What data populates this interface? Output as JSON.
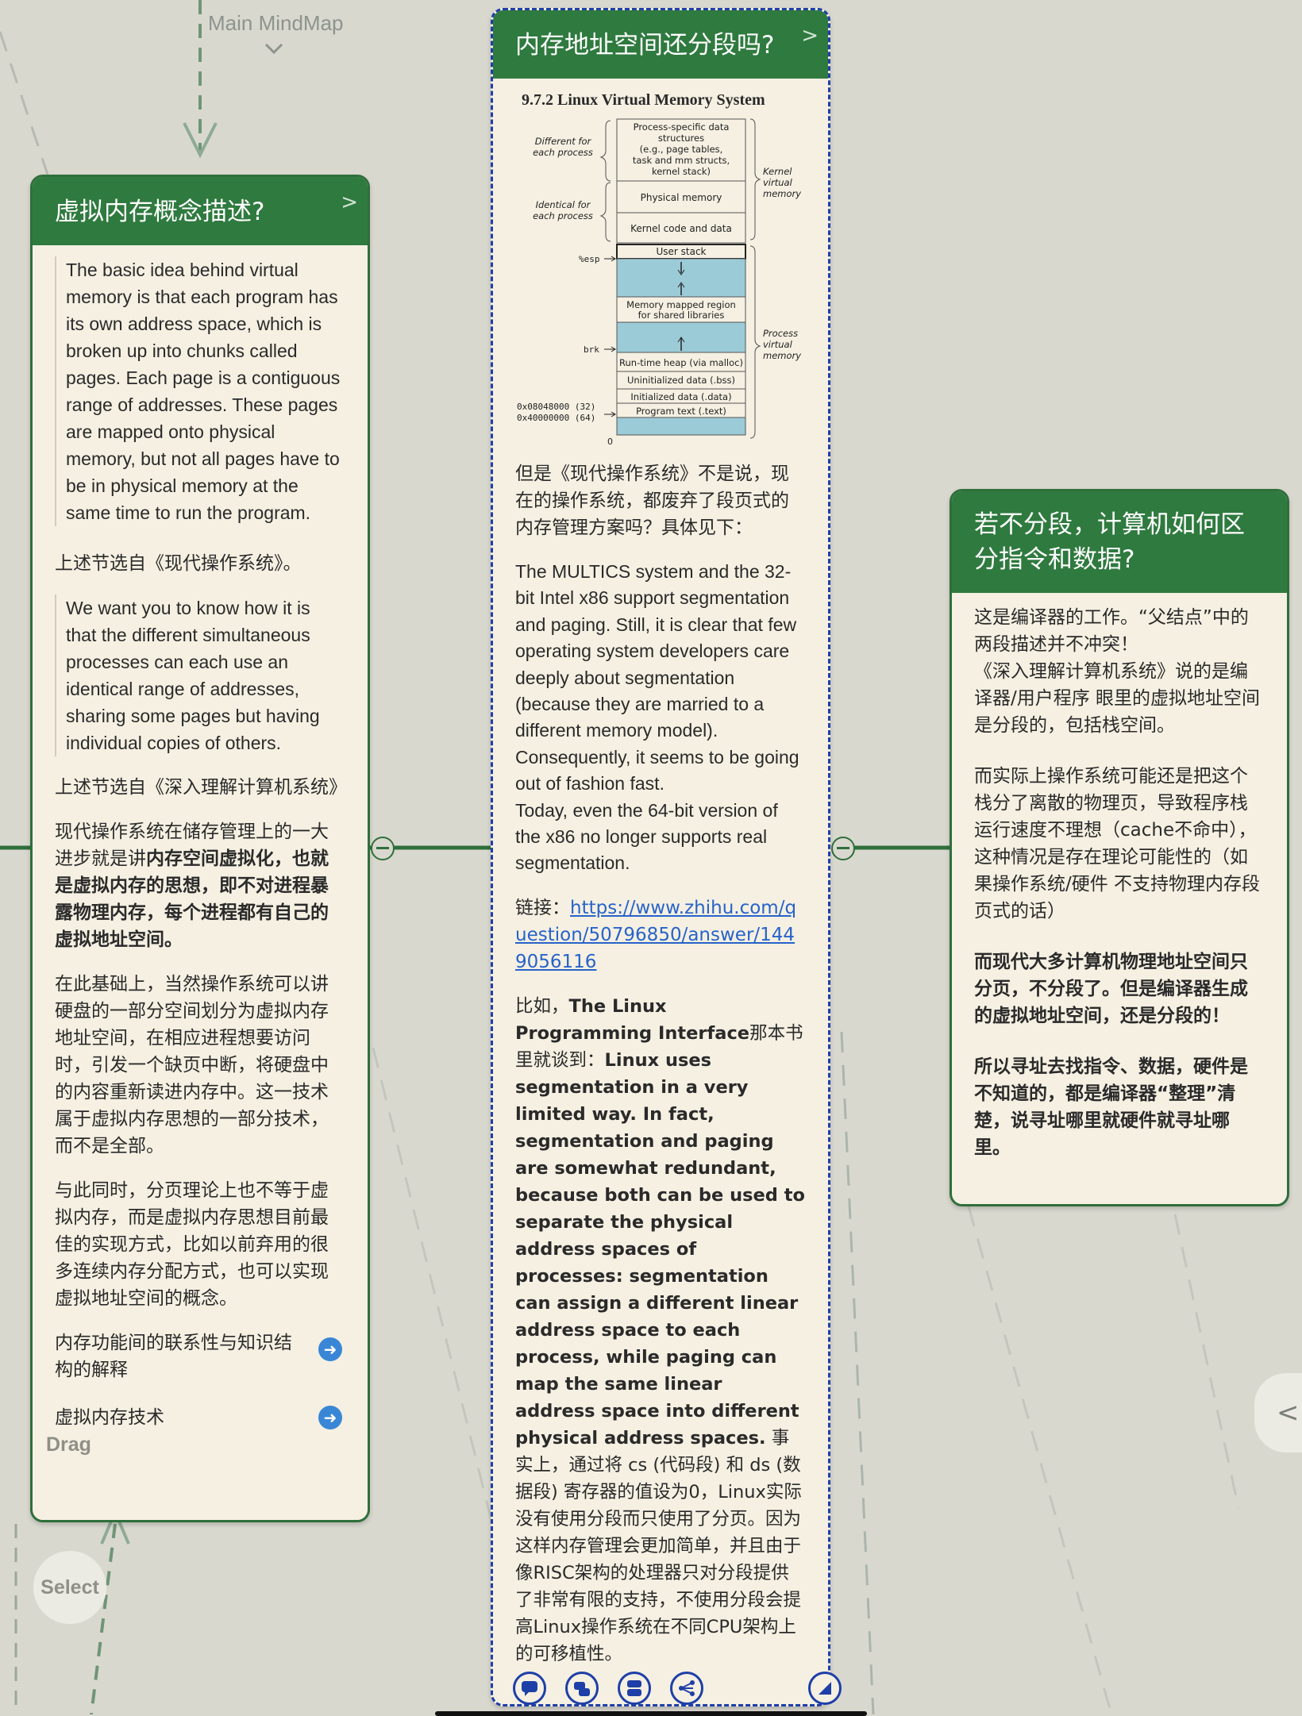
{
  "top": {
    "link": "Main MindMap"
  },
  "left_card": {
    "title": "虚拟内存概念描述?",
    "quote1": "The basic idea behind virtual memory is that each program has its own address space, which is broken up into chunks called pages. Each page is a contiguous range of addresses. These pages are mapped onto physical memory, but not all pages have to be in physical memory at the same time to run the program.",
    "source1": "上述节选自《现代操作系统》。",
    "quote2": "We want you to know how it is that the different simultaneous processes can each use an identical range of addresses, sharing some pages but having individual copies of others.",
    "source2": "上述节选自《深入理解计算机系统》",
    "para3_pre": "现代操作系统在储存管理上的一大进步就是讲",
    "para3_bold": "内存空间虚拟化，也就是虚拟内存的思想，即不对进程暴露物理内存，每个进程都有自己的虚拟地址空间。",
    "para4": "在此基础上，当然操作系统可以讲硬盘的一部分空间划分为虚拟内存地址空间，在相应进程想要访问时，引发一个缺页中断，将硬盘中的内容重新读进内存中。这一技术属于虚拟内存思想的一部分技术，而不是全部。",
    "para5": "与此同时，分页理论上也不等于虚拟内存，而是虚拟内存思想目前最佳的实现方式，比如以前弃用的很多连续内存分配方式，也可以实现虚拟地址空间的概念。",
    "list": [
      "内存功能间的联系性与知识结构的解释",
      "虚拟内存技术"
    ]
  },
  "middle_card": {
    "title": "内存地址空间还分段吗?",
    "figure": {
      "heading": "9.7.2   Linux Virtual Memory System",
      "side_top": "Different for each process",
      "side_mid": "Identical for each process",
      "kernel_label": "Kernel virtual memory",
      "process_label": "Process virtual memory",
      "blocks": [
        "Process-specific data structures (e.g., page tables, task and mm structs, kernel stack)",
        "Physical memory",
        "Kernel code and data",
        "User stack",
        "Memory mapped region for shared libraries",
        "Run-time heap (via malloc)",
        "Uninitialized data (.bss)",
        "Initialized data (.data)",
        "Program text (.text)"
      ],
      "esp": "%esp",
      "brk": "brk",
      "addr32": "0x08048000 (32)",
      "addr64": "0x40000000 (64)",
      "zero": "0"
    },
    "para1": "但是《现代操作系统》不是说，现在的操作系统，都废弃了段页式的内存管理方案吗？具体见下：",
    "para2": "The MULTICS system and the 32-bit Intel x86 support segmentation and paging. Still, it is clear that few operating system developers care deeply about segmentation (because they are married to a different memory model). Consequently, it seems to be going out of fashion fast.",
    "para2b": "Today, even the 64-bit version of the x86 no longer supports real segmentation.",
    "link_label": "链接：",
    "link_url": "https://www.zhihu.com/question/50796850/answer/1449056116",
    "para3_pre": "比如，",
    "para3_bold": "The Linux Programming Interface",
    "para3_mid": "那本书里就谈到：",
    "para3_en": "Linux uses segmentation in a very limited way. In fact, segmentation and paging are somewhat redundant, because both can be used to separate the physical address spaces of processes: segmentation can assign a different linear address space to each process, while paging can map the same linear address space into different physical address spaces.",
    "para3_zh": " 事实上，通过将 cs (代码段) 和 ds (数据段) 寄存器的值设为0，Linux实际没有使用分段而只使用了分页。因为这样内存管理会更加简单，并且由于像RISC架构的处理器只对分段提供了非常有限的支持，不使用分段会提高Linux操作系统在不同CPU架构上的可移植性。"
  },
  "right_card": {
    "title": "若不分段，计算机如何区分指令和数据?",
    "para1": "这是编译器的工作。“父结点”中的两段描述并不冲突！\n《深入理解计算机系统》说的是编译器/用户程序 眼里的虚拟地址空间是分段的，包括栈空间。",
    "para2": "而实际上操作系统可能还是把这个栈分了离散的物理页，导致程序栈运行速度不理想（cache不命中），这种情况是存在理论可能性的（如果操作系统/硬件 不支持物理内存段页式的话）",
    "para3": "而现代大多计算机物理地址空间只分页，不分段了。但是编译器生成的虚拟地址空间，还是分段的！",
    "para4": "所以寻址去找指令、数据，硬件是不知道的，都是编译器“整理”清楚，说寻址哪里就硬件就寻址哪里。"
  },
  "overlay": {
    "drag": "Drag",
    "select": "Select"
  },
  "colors": {
    "header": "#2f7a3f",
    "card_bg": "#f5f0e2",
    "canvas": "#d9d8cf",
    "selection": "#1e3fa8",
    "link": "#2763c9"
  }
}
